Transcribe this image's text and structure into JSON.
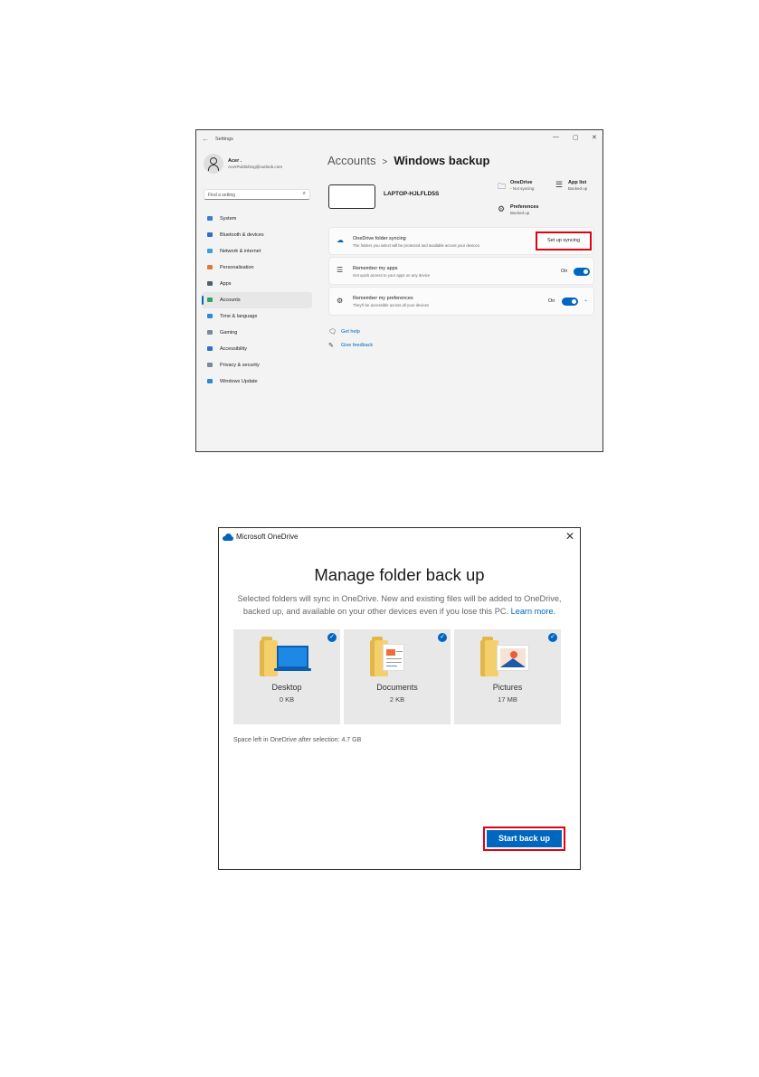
{
  "settings": {
    "back_glyph": "←",
    "title": "Settings",
    "window_controls": {
      "minimize": "—",
      "maximize": "▢",
      "close": "✕"
    },
    "profile": {
      "name": "Acer .",
      "email": "AcerPublishing@outlook.com"
    },
    "search": {
      "placeholder": "Find a setting",
      "icon": "search-icon"
    },
    "nav": [
      {
        "label": "System",
        "icon": "system-icon",
        "color": "#3a7bd5"
      },
      {
        "label": "Bluetooth & devices",
        "icon": "bluetooth-icon",
        "color": "#2f6fd0"
      },
      {
        "label": "Network & internet",
        "icon": "network-icon",
        "color": "#3aa0e0"
      },
      {
        "label": "Personalisation",
        "icon": "brush-icon",
        "color": "#e07a3a"
      },
      {
        "label": "Apps",
        "icon": "apps-icon",
        "color": "#55606e"
      },
      {
        "label": "Accounts",
        "icon": "accounts-icon",
        "color": "#2fa36b",
        "selected": true
      },
      {
        "label": "Time & language",
        "icon": "clock-icon",
        "color": "#2f8ad0"
      },
      {
        "label": "Gaming",
        "icon": "gaming-icon",
        "color": "#7a8a9a"
      },
      {
        "label": "Accessibility",
        "icon": "accessibility-icon",
        "color": "#2f6fd0"
      },
      {
        "label": "Privacy & security",
        "icon": "shield-icon",
        "color": "#7a8a9a"
      },
      {
        "label": "Windows Update",
        "icon": "update-icon",
        "color": "#2f8ad0"
      }
    ],
    "breadcrumb": {
      "parent": "Accounts",
      "separator": ">",
      "current": "Windows backup"
    },
    "device": {
      "name": "LAPTOP-HJLFLD5S"
    },
    "status": {
      "onedrive": {
        "title": "OneDrive",
        "dot": "•",
        "subtitle": "Not syncing",
        "icon": "folder-icon"
      },
      "app_list": {
        "title": "App list",
        "subtitle": "Backed up",
        "icon": "list-icon"
      },
      "preferences": {
        "title": "Preferences",
        "subtitle": "Backed up",
        "icon": "gear-icon"
      }
    },
    "cards": {
      "folder_sync": {
        "title": "OneDrive folder syncing",
        "subtitle": "The folders you select will be protected and available across your devices",
        "button": "Set up syncing"
      },
      "apps": {
        "title": "Remember my apps",
        "subtitle": "Get quick access to your apps on any device",
        "toggle_label": "On",
        "toggle_on": true
      },
      "prefs": {
        "title": "Remember my preferences",
        "subtitle": "They'll be accessible across all your devices",
        "toggle_label": "On",
        "toggle_on": true,
        "chevron": "⌄"
      }
    },
    "links": {
      "help": "Get help",
      "feedback": "Give feedback"
    },
    "accent": "#0067c0",
    "highlight": "#e3000f"
  },
  "onedrive": {
    "title": "Microsoft OneDrive",
    "close": "✕",
    "heading": "Manage folder back up",
    "description": "Selected folders will sync in OneDrive. New and existing files will be added to OneDrive, backed up, and available on your other devices even if you lose this PC.",
    "learn_more": "Learn more.",
    "folders": [
      {
        "name": "Desktop",
        "size": "0 KB",
        "checked": true
      },
      {
        "name": "Documents",
        "size": "2 KB",
        "checked": true
      },
      {
        "name": "Pictures",
        "size": "17 MB",
        "checked": true
      }
    ],
    "check_glyph": "✓",
    "space_left": "Space left in OneDrive after selection: 4.7 GB",
    "start_button": "Start back up"
  }
}
